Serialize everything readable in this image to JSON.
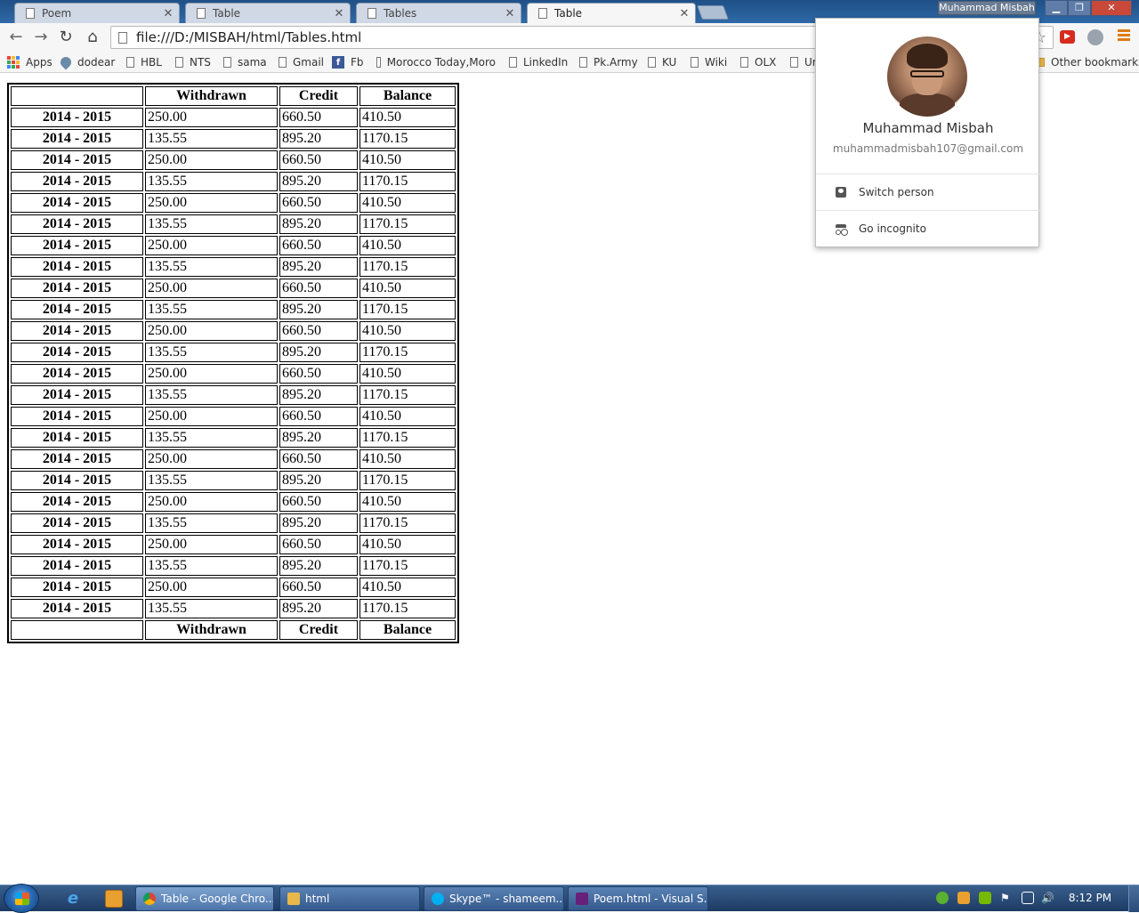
{
  "tabs": [
    {
      "label": "Poem"
    },
    {
      "label": "Table"
    },
    {
      "label": "Tables"
    },
    {
      "label": "Table"
    }
  ],
  "window": {
    "profile_name": "Muhammad Misbah"
  },
  "address_bar": {
    "url": "file:///D:/MISBAH/html/Tables.html"
  },
  "bookmarks": {
    "items": [
      "Apps",
      "dodear",
      "HBL",
      "NTS",
      "sama",
      "Gmail",
      "Fb",
      "Morocco Today,Moro",
      "LinkedIn",
      "Pk.Army",
      "KU",
      "Wiki",
      "OLX",
      "Ur"
    ],
    "other": "Other bookmarks"
  },
  "table": {
    "headers": [
      "",
      "Withdrawn",
      "Credit",
      "Balance"
    ],
    "rows": [
      [
        "2014 - 2015",
        "250.00",
        "660.50",
        "410.50"
      ],
      [
        "2014 - 2015",
        "135.55",
        "895.20",
        "1170.15"
      ],
      [
        "2014 - 2015",
        "250.00",
        "660.50",
        "410.50"
      ],
      [
        "2014 - 2015",
        "135.55",
        "895.20",
        "1170.15"
      ],
      [
        "2014 - 2015",
        "250.00",
        "660.50",
        "410.50"
      ],
      [
        "2014 - 2015",
        "135.55",
        "895.20",
        "1170.15"
      ],
      [
        "2014 - 2015",
        "250.00",
        "660.50",
        "410.50"
      ],
      [
        "2014 - 2015",
        "135.55",
        "895.20",
        "1170.15"
      ],
      [
        "2014 - 2015",
        "250.00",
        "660.50",
        "410.50"
      ],
      [
        "2014 - 2015",
        "135.55",
        "895.20",
        "1170.15"
      ],
      [
        "2014 - 2015",
        "250.00",
        "660.50",
        "410.50"
      ],
      [
        "2014 - 2015",
        "135.55",
        "895.20",
        "1170.15"
      ],
      [
        "2014 - 2015",
        "250.00",
        "660.50",
        "410.50"
      ],
      [
        "2014 - 2015",
        "135.55",
        "895.20",
        "1170.15"
      ],
      [
        "2014 - 2015",
        "250.00",
        "660.50",
        "410.50"
      ],
      [
        "2014 - 2015",
        "135.55",
        "895.20",
        "1170.15"
      ],
      [
        "2014 - 2015",
        "250.00",
        "660.50",
        "410.50"
      ],
      [
        "2014 - 2015",
        "135.55",
        "895.20",
        "1170.15"
      ],
      [
        "2014 - 2015",
        "250.00",
        "660.50",
        "410.50"
      ],
      [
        "2014 - 2015",
        "135.55",
        "895.20",
        "1170.15"
      ],
      [
        "2014 - 2015",
        "250.00",
        "660.50",
        "410.50"
      ],
      [
        "2014 - 2015",
        "135.55",
        "895.20",
        "1170.15"
      ],
      [
        "2014 - 2015",
        "250.00",
        "660.50",
        "410.50"
      ],
      [
        "2014 - 2015",
        "135.55",
        "895.20",
        "1170.15"
      ]
    ],
    "footer": [
      "",
      "Withdrawn",
      "Credit",
      "Balance"
    ]
  },
  "profile_menu": {
    "name": "Muhammad Misbah",
    "email": "muhammadmisbah107@gmail.com",
    "switch_person": "Switch person",
    "go_incognito": "Go incognito"
  },
  "taskbar": {
    "items": [
      "Table - Google Chro...",
      "html",
      "Skype™ - shameem....",
      "Poem.html - Visual S..."
    ],
    "clock": "8:12 PM"
  },
  "colors": {
    "titlebar": "#2f6aa8",
    "menu_accent": "#e07b14",
    "youtube_red": "#d62b1f",
    "taskbar": "#1c3b64"
  }
}
